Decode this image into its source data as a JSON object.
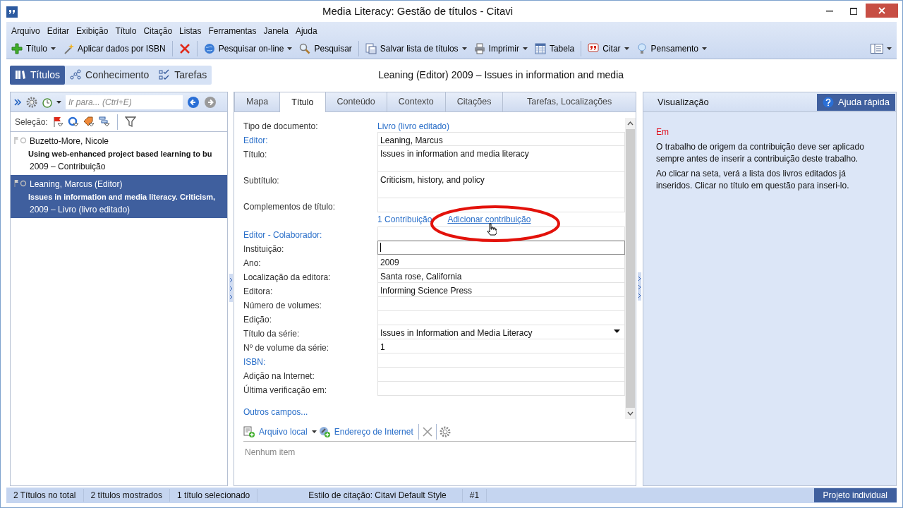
{
  "window": {
    "title": "Media Literacy: Gestão de títulos - Citavi"
  },
  "menu": [
    "Arquivo",
    "Editar",
    "Exibição",
    "Título",
    "Citação",
    "Listas",
    "Ferramentas",
    "Janela",
    "Ajuda"
  ],
  "toolbar": [
    {
      "kind": "button",
      "label": "Título",
      "dropdown": true
    },
    {
      "kind": "button",
      "label": "Aplicar dados por ISBN",
      "dropdown": false
    },
    {
      "kind": "separator"
    },
    {
      "kind": "button"
    },
    {
      "kind": "separator"
    },
    {
      "kind": "button",
      "label": "Pesquisar on-line",
      "dropdown": true
    },
    {
      "kind": "button",
      "label": "Pesquisar",
      "dropdown": false
    },
    {
      "kind": "separator"
    },
    {
      "kind": "button",
      "label": "Salvar lista de títulos",
      "dropdown": true
    },
    {
      "kind": "button",
      "label": "Imprimir",
      "dropdown": true
    },
    {
      "kind": "button",
      "label": "Tabela",
      "dropdown": false
    },
    {
      "kind": "separator"
    },
    {
      "kind": "button",
      "label": "Citar",
      "dropdown": true
    },
    {
      "kind": "button",
      "label": "Pensamento",
      "dropdown": true
    }
  ],
  "toolbar_right": {
    "dropdown": true
  },
  "nav_tabs": [
    {
      "label": "Títulos",
      "selected": true
    },
    {
      "label": "Conhecimento",
      "selected": false
    },
    {
      "label": "Tarefas",
      "selected": false
    }
  ],
  "current_title": "Leaning (Editor) 2009 – Issues in information and media",
  "left_panel": {
    "search": {
      "placeholder": "Ir para... (Ctrl+E)"
    },
    "nav_buttons": [
      {
        "disabled": false
      },
      {
        "disabled": true
      }
    ],
    "selection_label": "Seleção:",
    "items": [
      {
        "author": "Buzetto-More, Nicole",
        "title": "Using web-enhanced project based learning to bu",
        "meta": "2009 – Contribuição",
        "selected": false
      },
      {
        "author": "Leaning, Marcus (Editor)",
        "title": "Issues in information and media literacy. Criticism,",
        "meta": "2009 – Livro (livro editado)",
        "selected": true
      }
    ]
  },
  "center_tabs": [
    {
      "label": "Mapa",
      "selected": false
    },
    {
      "label": "Título",
      "selected": true
    },
    {
      "label": "Conteúdo",
      "selected": false
    },
    {
      "label": "Contexto",
      "selected": false
    },
    {
      "label": "Citações",
      "selected": false
    },
    {
      "label": "Tarefas, Localizações",
      "selected": false
    }
  ],
  "fields": [
    {
      "kind": "link",
      "label": "Tipo de documento:",
      "label_link": false,
      "value": "Livro (livro editado)"
    },
    {
      "kind": "box",
      "label": "Editor:",
      "label_link": true,
      "value": "Leaning, Marcus"
    },
    {
      "kind": "tall",
      "label": "Título:",
      "label_link": false,
      "value": "Issues in information and media literacy"
    },
    {
      "kind": "tall",
      "label": "Subtítulo:",
      "label_link": false,
      "value": "Criticism, history, and policy"
    },
    {
      "kind": "box",
      "label": "Complementos de título:",
      "label_link": false
    },
    {
      "kind": "links",
      "links": [
        "1 Contribuição",
        "Adicionar contribuição"
      ]
    },
    {
      "kind": "box",
      "label": "Editor - Colaborador:",
      "label_link": true
    },
    {
      "kind": "focused",
      "label": "Instituição:",
      "label_link": false
    },
    {
      "kind": "box",
      "label": "Ano:",
      "label_link": false,
      "value": "2009"
    },
    {
      "kind": "box",
      "label": "Localização da editora:",
      "label_link": false,
      "value": "Santa rose, California"
    },
    {
      "kind": "box",
      "label": "Editora:",
      "label_link": false,
      "value": "Informing Science Press"
    },
    {
      "kind": "box",
      "label": "Número de volumes:",
      "label_link": false
    },
    {
      "kind": "box",
      "label": "Edição:",
      "label_link": false
    },
    {
      "kind": "dropdown",
      "label": "Título da série:",
      "label_link": false,
      "value": "Issues in Information and Media Literacy"
    },
    {
      "kind": "box",
      "label": "Nº de volume da série:",
      "label_link": false,
      "value": "1"
    },
    {
      "kind": "box",
      "label": "ISBN:",
      "label_link": true
    },
    {
      "kind": "box",
      "label": "Adição na Internet:",
      "label_link": false
    },
    {
      "kind": "box",
      "label": "Última verificação em:",
      "label_link": false
    }
  ],
  "more_fields": "Outros campos...",
  "attachments": {
    "buttons": [
      {
        "label": "Arquivo local",
        "dropdown": true
      },
      {
        "label": "Endereço de Internet",
        "dropdown": false
      }
    ],
    "empty": "Nenhum item"
  },
  "right_panel": {
    "title": "Visualização",
    "help_button": "Ajuda rápida",
    "heading": "Em",
    "paragraphs": [
      "O trabalho de origem da contribuição deve ser aplicado sempre antes de inserir a contribuição deste trabalho.",
      "Ao clicar na seta, verá a lista dos livros editados já inseridos. Clicar no título em questão para inseri-lo."
    ]
  },
  "status_bar": {
    "items": [
      "2 Títulos no total",
      "2 títulos mostrados",
      "1 título selecionado",
      "Estilo de citação: Citavi Default Style",
      "#1"
    ],
    "project_button": "Projeto individual"
  }
}
